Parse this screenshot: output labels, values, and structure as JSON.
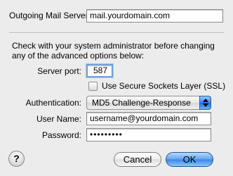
{
  "server": {
    "label": "Outgoing Mail Server:",
    "value": "mail.yourdomain.com"
  },
  "description": "Check with your system administrator before changing any of the advanced options below:",
  "port": {
    "label": "Server port:",
    "value": "587"
  },
  "ssl": {
    "label": "Use Secure Sockets Layer (SSL)",
    "checked": false
  },
  "auth": {
    "label": "Authentication:",
    "value": "MD5 Challenge-Response"
  },
  "username": {
    "label": "User Name:",
    "value": "username@yourdomain.com"
  },
  "password": {
    "label": "Password:",
    "value": "•••••••••"
  },
  "help": {
    "symbol": "?"
  },
  "buttons": {
    "cancel": "Cancel",
    "ok": "OK"
  }
}
